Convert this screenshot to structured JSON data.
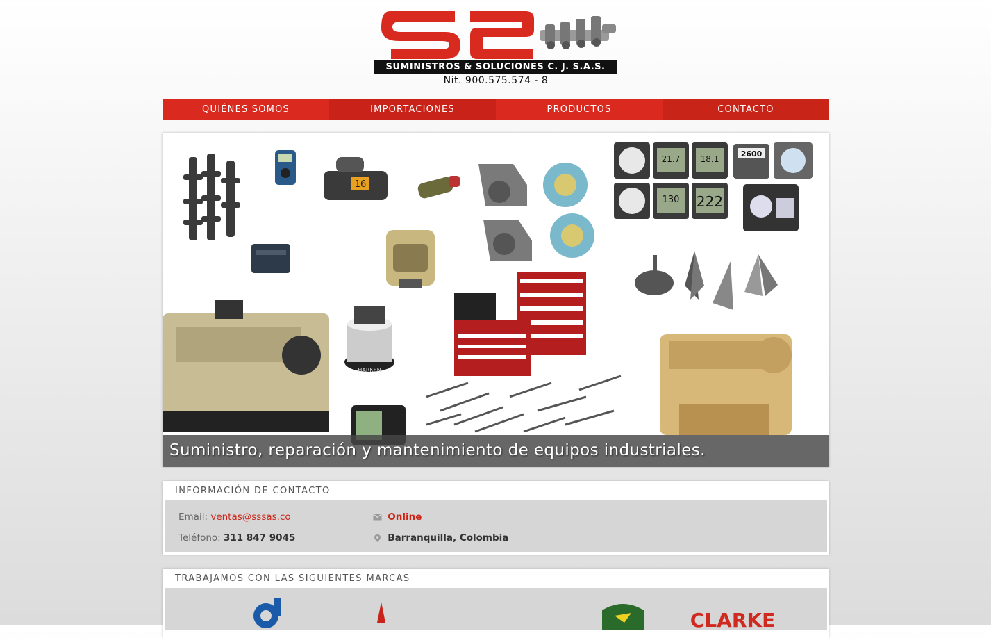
{
  "logo": {
    "bar_text": "SUMINISTROS & SOLUCIONES C. J. S.A.S.",
    "nit": "Nit. 900.575.574 - 8"
  },
  "nav": [
    {
      "label": "QUIÉNES SOMOS"
    },
    {
      "label": "IMPORTACIONES"
    },
    {
      "label": "PRODUCTOS"
    },
    {
      "label": "CONTACTO"
    }
  ],
  "banner": {
    "caption": "Suministro, reparación y mantenimiento de equipos industriales.",
    "product_labels": {
      "harken": "HARKEN",
      "gauge_1": "21.7",
      "gauge_2": "18.1",
      "gauge_3": "2600",
      "gauge_4": "130",
      "gauge_5": "222",
      "radio": "16"
    }
  },
  "contact": {
    "title": "INFORMACIÓN DE CONTACTO",
    "email_label": "Email:",
    "email_value": "ventas@sssas.co",
    "phone_label": "Teléfono:",
    "phone_value": "311 847 9045",
    "status": "Online",
    "location": "Barranquilla, Colombia"
  },
  "brands": {
    "title": "TRABAJAMOS CON LAS SIGUIENTES MARCAS",
    "clarke": "CLARKE"
  },
  "colors": {
    "brand_red": "#da2a1f",
    "nav_dark_red": "#c92218"
  }
}
